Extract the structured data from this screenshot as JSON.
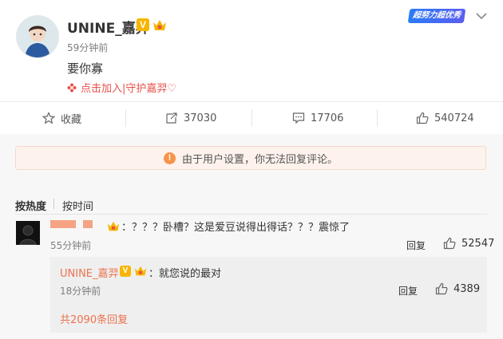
{
  "post": {
    "username": "UNINE_嘉羿",
    "verified_badge": "V",
    "time": "59分钟前",
    "content": "要你寡",
    "super_topic": "点击加入|守护嘉羿♡",
    "promo_badge": "超努力超优秀"
  },
  "actions": {
    "favorite": "收藏",
    "repost": "37030",
    "comment": "17706",
    "like": "540724"
  },
  "notice": {
    "icon": "!",
    "text": "由于用户设置，你无法回复评论。"
  },
  "sort": {
    "hot": "按热度",
    "time": "按时间"
  },
  "comment": {
    "text": "：？？？卧槽？这是爱豆说得出得话？？？震惊了",
    "time": "55分钟前",
    "reply_label": "回复",
    "likes": "52547"
  },
  "reply": {
    "username": "UNINE_嘉羿",
    "verified_badge": "V",
    "text": "：就您说的最对",
    "time": "18分钟前",
    "reply_label": "回复",
    "likes": "4389"
  },
  "more_replies": "共2090条回复",
  "colors": {
    "accent_orange": "#eb7350",
    "verified_gold": "#f7b500",
    "notice_bg": "#fdf2ec"
  }
}
